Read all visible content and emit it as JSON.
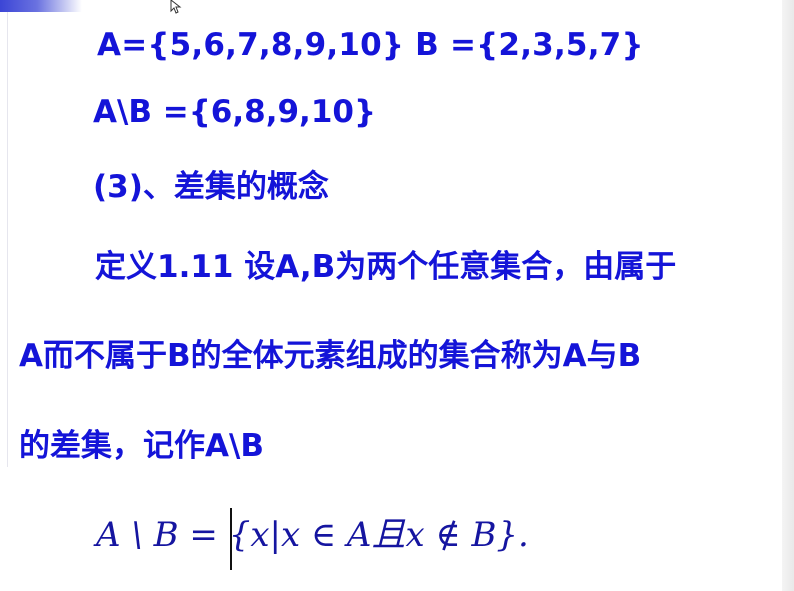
{
  "slide": {
    "line_sets": "A={5,6,7,8,9,10}   B ={2,3,5,7}",
    "line_difference": "A\\B  ={6,8,9,10}",
    "heading": "(3)、差集的概念",
    "definition_line1": "定义1.11 设A,B为两个任意集合，由属于",
    "definition_line2": "A而不属于B的全体元素组成的集合称为A与B",
    "definition_line3": "的差集，记作A\\B",
    "formula": "A \\ B = {x|x ∈ A且x ∉ B}."
  },
  "icons": {
    "pointer": "mouse-pointer-icon"
  },
  "colors": {
    "text": "#1414d8",
    "formula": "#1515a0",
    "accent_bar": "#3b45d6"
  }
}
